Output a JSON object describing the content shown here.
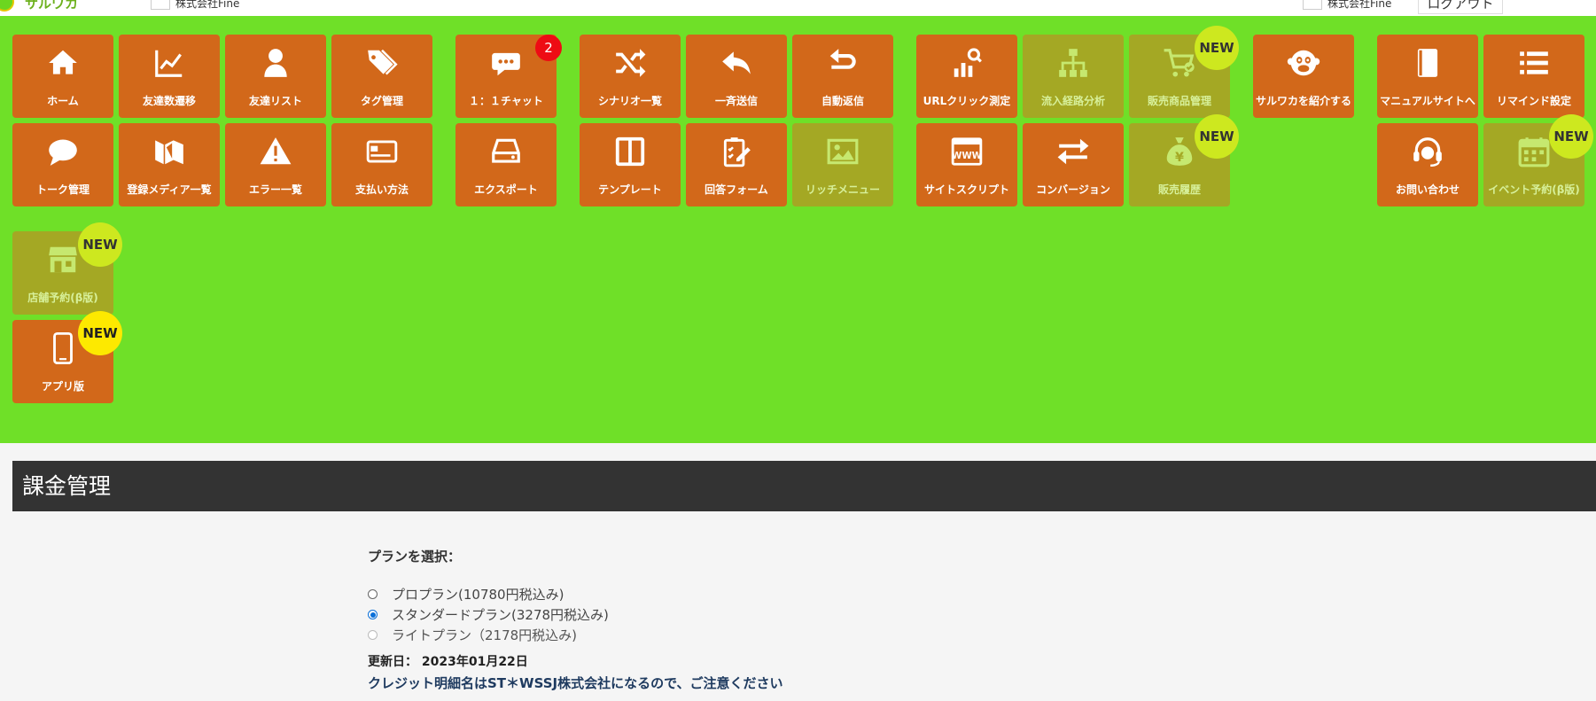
{
  "header": {
    "logo_text": "サルワカ",
    "company_left": "株式会社Fine",
    "company_right": "株式会社Fine",
    "logout_label": "ログアウト"
  },
  "colors": {
    "menu_background": "#6fe028",
    "tile_active": "#d2681a",
    "tile_disabled": "#a4a824",
    "badge_new": "#cde81f",
    "badge_new_app": "#fde900",
    "badge_count": "#ee0b14",
    "section_header": "#333333",
    "radio_selected": "#0a6fd8"
  },
  "menu": [
    {
      "id": "home",
      "label": "ホーム",
      "icon": "home-icon",
      "enabled": true
    },
    {
      "id": "friend-trend",
      "label": "友達数遷移",
      "icon": "line-chart-icon",
      "enabled": true
    },
    {
      "id": "friend-list",
      "label": "友達リスト",
      "icon": "user-icon",
      "enabled": true
    },
    {
      "id": "tag-manage",
      "label": "タグ管理",
      "icon": "tags-icon",
      "enabled": true
    },
    {
      "id": "chat",
      "label": "１：１チャット",
      "icon": "chat-bubble-icon",
      "enabled": true,
      "badge_count": "2"
    },
    {
      "id": "scenario-list",
      "label": "シナリオ一覧",
      "icon": "shuffle-icon",
      "enabled": true
    },
    {
      "id": "broadcast",
      "label": "一斉送信",
      "icon": "reply-icon",
      "enabled": true
    },
    {
      "id": "auto-reply",
      "label": "自動返信",
      "icon": "return-icon",
      "enabled": true
    },
    {
      "id": "url-click",
      "label": "URLクリック測定",
      "icon": "analytics-search-icon",
      "enabled": true
    },
    {
      "id": "inflow-analysis",
      "label": "流入経路分析",
      "icon": "sitemap-icon",
      "enabled": false
    },
    {
      "id": "product-manage",
      "label": "販売商品管理",
      "icon": "cart-check-icon",
      "enabled": false,
      "badge": "NEW"
    },
    {
      "id": "refer",
      "label": "サルワカを紹介する",
      "icon": "monkey-icon",
      "enabled": true
    },
    {
      "id": "manual-site",
      "label": "マニュアルサイトへ",
      "icon": "book-icon",
      "enabled": true
    },
    {
      "id": "remind-settings",
      "label": "リマインド設定",
      "icon": "list-icon",
      "enabled": true
    },
    {
      "id": "talk-manage",
      "label": "トーク管理",
      "icon": "speech-bubble-icon",
      "enabled": true
    },
    {
      "id": "media-list",
      "label": "登録メディア一覧",
      "icon": "media-logo-icon",
      "enabled": true
    },
    {
      "id": "error-list",
      "label": "エラー一覧",
      "icon": "warning-icon",
      "enabled": true
    },
    {
      "id": "payment",
      "label": "支払い方法",
      "icon": "credit-card-icon",
      "enabled": true
    },
    {
      "id": "export",
      "label": "エクスポート",
      "icon": "hdd-icon",
      "enabled": true
    },
    {
      "id": "template",
      "label": "テンプレート",
      "icon": "columns-icon",
      "enabled": true
    },
    {
      "id": "answer-form",
      "label": "回答フォーム",
      "icon": "clipboard-edit-icon",
      "enabled": true
    },
    {
      "id": "rich-menu",
      "label": "リッチメニュー",
      "icon": "image-icon",
      "enabled": false
    },
    {
      "id": "site-script",
      "label": "サイトスクリプト",
      "icon": "www-icon",
      "enabled": true
    },
    {
      "id": "conversion",
      "label": "コンバージョン",
      "icon": "exchange-icon",
      "enabled": true
    },
    {
      "id": "sales-history",
      "label": "販売履歴",
      "icon": "money-bag-icon",
      "enabled": false,
      "badge": "NEW"
    },
    {
      "id": "contact",
      "label": "お問い合わせ",
      "icon": "headset-icon",
      "enabled": true
    },
    {
      "id": "event-reservation",
      "label": "イベント予約(β版)",
      "icon": "calendar-icon",
      "enabled": false,
      "badge": "NEW"
    },
    {
      "id": "store-reservation",
      "label": "店舗予約(β版)",
      "icon": "store-icon",
      "enabled": false,
      "badge": "NEW"
    },
    {
      "id": "app-version",
      "label": "アプリ版",
      "icon": "smartphone-icon",
      "enabled": true,
      "badge": "NEW"
    }
  ],
  "billing": {
    "title": "課金管理",
    "plan_select_label": "プランを選択：",
    "plans": [
      {
        "label": "プロプラン(10780円税込み)",
        "selected": false,
        "disabled": false
      },
      {
        "label": "スタンダードプラン(3278円税込み)",
        "selected": true,
        "disabled": false
      },
      {
        "label": "ライトプラン（2178円税込み)",
        "selected": false,
        "disabled": true
      }
    ],
    "updated_text": "更新日： 2023年01月22日",
    "notice_text": "クレジット明細名はST＊WSSJ株式会社になるので、ご注意ください"
  }
}
